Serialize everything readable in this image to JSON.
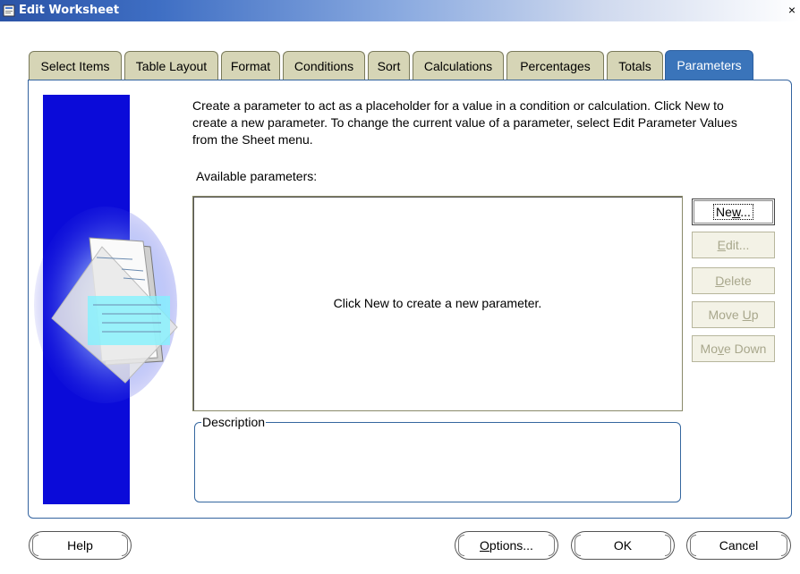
{
  "window": {
    "title": "Edit Worksheet",
    "close_glyph": "×"
  },
  "tabs": [
    {
      "label": "Select Items",
      "active": false
    },
    {
      "label": "Table Layout",
      "active": false
    },
    {
      "label": "Format",
      "active": false
    },
    {
      "label": "Conditions",
      "active": false
    },
    {
      "label": "Sort",
      "active": false
    },
    {
      "label": "Calculations",
      "active": false
    },
    {
      "label": "Percentages",
      "active": false
    },
    {
      "label": "Totals",
      "active": false
    },
    {
      "label": "Parameters",
      "active": true
    }
  ],
  "main": {
    "instructions": "Create a parameter to act as a placeholder for a value in a condition or calculation.  Click New to create a new parameter.  To change the current value of a parameter, select Edit Parameter Values from the Sheet menu.",
    "available_label": "Available parameters:",
    "empty_message": "Click New to create a new parameter.",
    "description_legend": "Description",
    "description_value": ""
  },
  "side_buttons": {
    "new": {
      "pre": "Ne",
      "key": "w",
      "post": "..."
    },
    "edit": {
      "pre": "",
      "key": "E",
      "post": "dit..."
    },
    "delete": {
      "pre": "",
      "key": "D",
      "post": "elete"
    },
    "move_up": {
      "pre": "Move ",
      "key": "U",
      "post": "p"
    },
    "move_down": {
      "pre": "Mo",
      "key": "v",
      "post": "e Down"
    }
  },
  "footer": {
    "help": "Help",
    "options": {
      "pre": "",
      "key": "O",
      "post": "ptions..."
    },
    "ok": "OK",
    "cancel": "Cancel"
  },
  "colors": {
    "tab_active": "#3a74ba",
    "tab_inactive": "#d6d5b6",
    "panel_border": "#33639f",
    "wizard_blue": "#0b0bd9"
  },
  "icons": {
    "app": "worksheet-icon",
    "wizard": "document-illustration"
  }
}
